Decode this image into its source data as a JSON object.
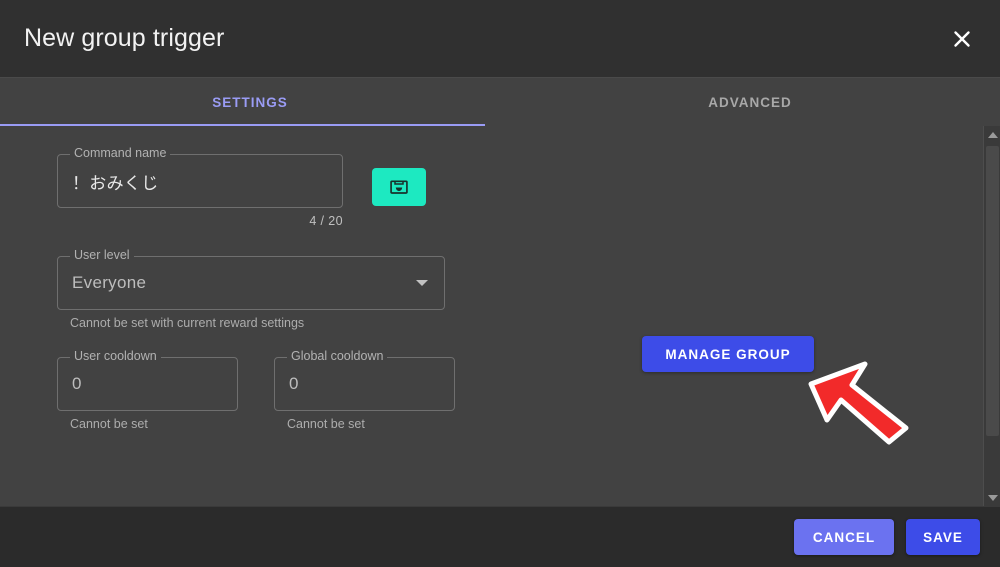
{
  "dialog": {
    "title": "New group trigger",
    "close_icon": "close-icon"
  },
  "tabs": [
    {
      "label": "SETTINGS",
      "active": true
    },
    {
      "label": "ADVANCED",
      "active": false
    }
  ],
  "form": {
    "command_name": {
      "label": "Command name",
      "value": "！おみくじ",
      "counter": "4 / 20",
      "action_button_icon": "inbox-icon"
    },
    "user_level": {
      "label": "User level",
      "value": "Everyone",
      "help": "Cannot be set with current reward settings",
      "dropdown_icon": "chevron-down-icon"
    },
    "user_cooldown": {
      "label": "User cooldown",
      "value": "0",
      "help": "Cannot be set"
    },
    "global_cooldown": {
      "label": "Global cooldown",
      "value": "0",
      "help": "Cannot be set"
    }
  },
  "actions": {
    "manage_group": "MANAGE GROUP",
    "cancel": "CANCEL",
    "save": "SAVE"
  },
  "scrollbar": {
    "up_icon": "scroll-up-arrow-icon",
    "down_icon": "scroll-down-arrow-icon"
  },
  "cursor": {
    "icon": "mouse-cursor-arrow-icon",
    "color": "#f22a2a"
  },
  "colors": {
    "accent_purple": "#9a9cf5",
    "accent_blue": "#3d4ce8",
    "cancel_blue": "#6b72f0",
    "teal": "#1de9c1",
    "header_bg": "#303030",
    "body_bg": "#424242",
    "footer_bg": "#2b2b2b"
  }
}
